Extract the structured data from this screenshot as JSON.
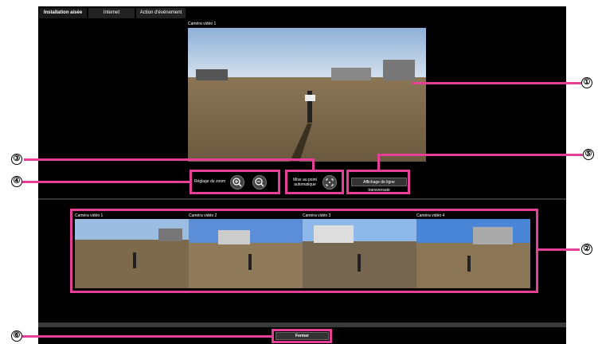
{
  "tabs": [
    {
      "label": "Installation aisée"
    },
    {
      "label": "Internet"
    },
    {
      "label": "Action d'événement"
    }
  ],
  "main_camera": {
    "caption": "Caméra vidéo 1"
  },
  "zoom": {
    "label": "Réglage du zoom"
  },
  "autofocus": {
    "label_line1": "Mise au point",
    "label_line2": "automatique"
  },
  "guide_button": {
    "label": "Affichage de ligne transversale"
  },
  "cameras": [
    {
      "caption": "Caméra vidéo 1"
    },
    {
      "caption": "Caméra vidéo 2"
    },
    {
      "caption": "Caméra vidéo 3"
    },
    {
      "caption": "Caméra vidéo 4"
    }
  ],
  "close_button": {
    "label": "Fermer"
  },
  "callouts": [
    "①",
    "②",
    "③",
    "④",
    "⑤",
    "⑥"
  ],
  "colors": {
    "accent": "#e63f97",
    "panel": "#000000"
  }
}
